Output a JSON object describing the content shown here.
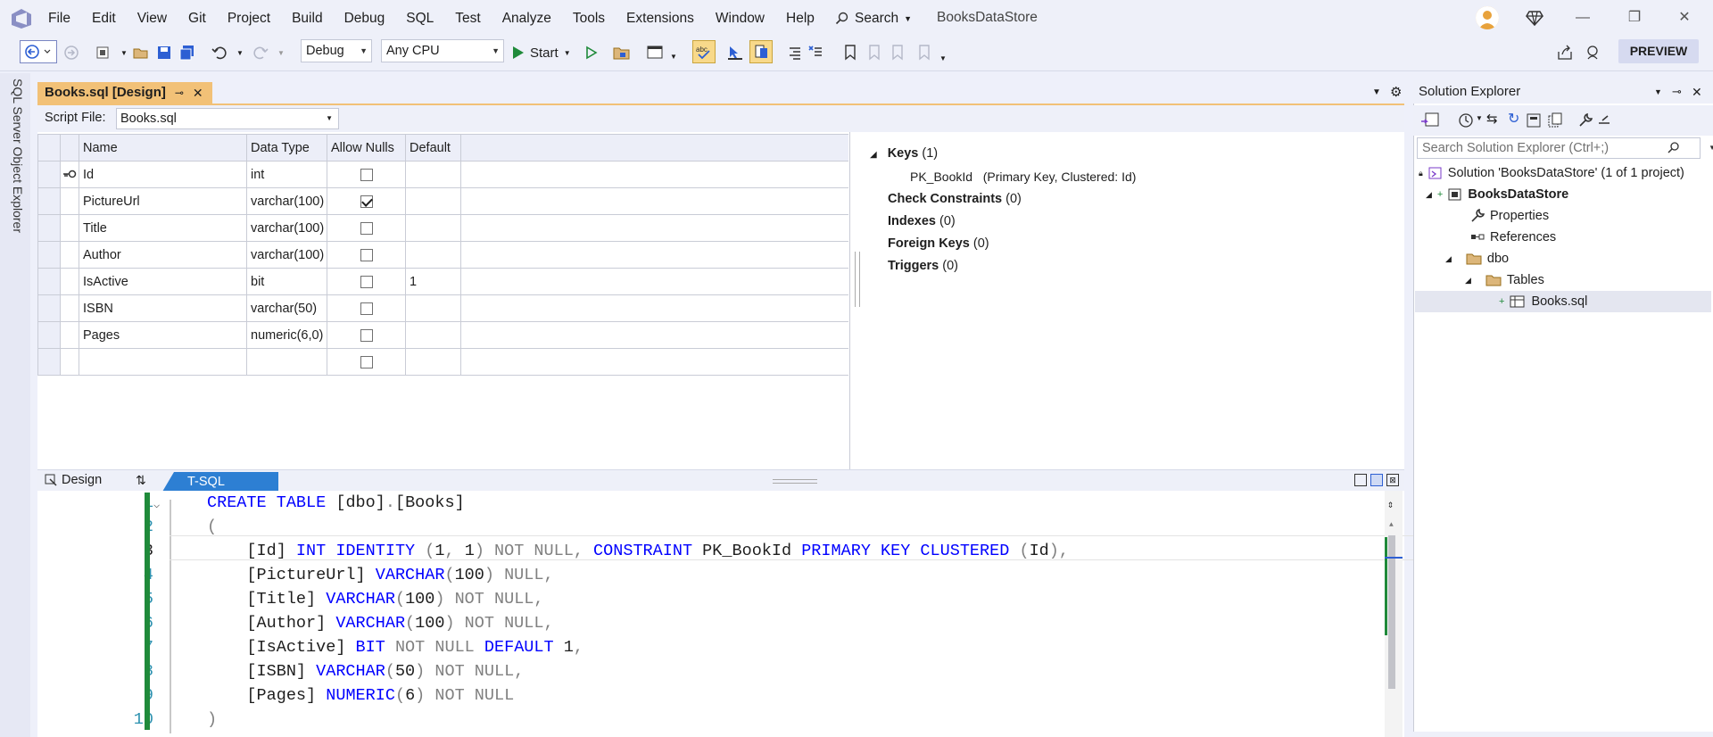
{
  "menu": [
    "File",
    "Edit",
    "View",
    "Git",
    "Project",
    "Build",
    "Debug",
    "SQL",
    "Test",
    "Analyze",
    "Tools",
    "Extensions",
    "Window",
    "Help"
  ],
  "search_label": "Search",
  "solution_title": "BooksDataStore",
  "toolbar": {
    "config": "Debug",
    "platform": "Any CPU",
    "start_label": "Start",
    "preview_label": "PREVIEW"
  },
  "left_strip_label": "SQL Server Object Explorer",
  "doc_tab": {
    "title": "Books.sql [Design]"
  },
  "designer": {
    "script_file_label": "Script File:",
    "script_file_value": "Books.sql",
    "columns": [
      "Name",
      "Data Type",
      "Allow Nulls",
      "Default"
    ],
    "rows": [
      {
        "name": "Id",
        "type": "int",
        "nulls": false,
        "default": "",
        "key": true
      },
      {
        "name": "PictureUrl",
        "type": "varchar(100)",
        "nulls": true,
        "default": "",
        "key": false
      },
      {
        "name": "Title",
        "type": "varchar(100)",
        "nulls": false,
        "default": "",
        "key": false
      },
      {
        "name": "Author",
        "type": "varchar(100)",
        "nulls": false,
        "default": "",
        "key": false
      },
      {
        "name": "IsActive",
        "type": "bit",
        "nulls": false,
        "default": "1",
        "key": false
      },
      {
        "name": "ISBN",
        "type": "varchar(50)",
        "nulls": false,
        "default": "",
        "key": false
      },
      {
        "name": "Pages",
        "type": "numeric(6,0)",
        "nulls": false,
        "default": "",
        "key": false
      },
      {
        "name": "",
        "type": "",
        "nulls": false,
        "default": "",
        "key": false
      }
    ],
    "props": {
      "keys": "Keys",
      "keys_count": "(1)",
      "key_name": "PK_BookId",
      "key_desc": "(Primary Key, Clustered: Id)",
      "check": "Check Constraints",
      "check_count": "(0)",
      "indexes": "Indexes",
      "indexes_count": "(0)",
      "fk": "Foreign Keys",
      "fk_count": "(0)",
      "triggers": "Triggers",
      "triggers_count": "(0)"
    },
    "design_tab": "Design",
    "tsql_tab": "T-SQL"
  },
  "code": {
    "line_numbers": [
      "1",
      "2",
      "3",
      "4",
      "5",
      "6",
      "7",
      "8",
      "9",
      "10"
    ]
  },
  "solution_explorer": {
    "title": "Solution Explorer",
    "search_placeholder": "Search Solution Explorer (Ctrl+;)",
    "solution": "Solution 'BooksDataStore' (1 of 1 project)",
    "project": "BooksDataStore",
    "properties": "Properties",
    "references": "References",
    "dbo": "dbo",
    "tables": "Tables",
    "file": "Books.sql"
  }
}
